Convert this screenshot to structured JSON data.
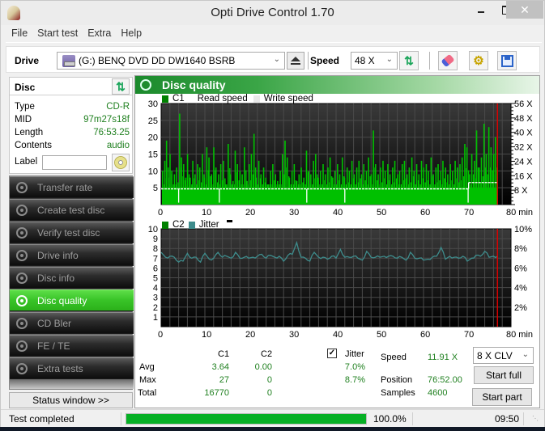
{
  "window": {
    "title": "Opti Drive Control 1.70",
    "controls": {
      "minimize": "–",
      "maximize": "□",
      "close": "✕"
    }
  },
  "menu": [
    "File",
    "Start test",
    "Extra",
    "Help"
  ],
  "toolbar": {
    "drive_label": "Drive",
    "drive_value": "(G:)  BENQ DVD DD DW1640 BSRB",
    "speed_label": "Speed",
    "speed_value": "48 X",
    "icons": [
      "drive-icon",
      "eject-icon",
      "refresh-icon",
      "erase-icon",
      "settings-icon",
      "save-icon"
    ]
  },
  "disc": {
    "title": "Disc",
    "fields": [
      {
        "key": "Type",
        "value": "CD-R"
      },
      {
        "key": "MID",
        "value": "97m27s18f"
      },
      {
        "key": "Length",
        "value": "76:53.25"
      },
      {
        "key": "Contents",
        "value": "audio"
      }
    ],
    "label_key": "Label",
    "label_value": ""
  },
  "nav": [
    {
      "label": "Transfer rate",
      "active": false
    },
    {
      "label": "Create test disc",
      "active": false
    },
    {
      "label": "Verify test disc",
      "active": false
    },
    {
      "label": "Drive info",
      "active": false
    },
    {
      "label": "Disc info",
      "active": false
    },
    {
      "label": "Disc quality",
      "active": true
    },
    {
      "label": "CD Bler",
      "active": false
    },
    {
      "label": "FE / TE",
      "active": false
    },
    {
      "label": "Extra tests",
      "active": false
    }
  ],
  "status_window_button": "Status window >>",
  "main": {
    "title": "Disc quality",
    "legend_top": [
      "C1",
      "Read speed",
      "Write speed"
    ],
    "legend_bottom": [
      "C2",
      "Jitter"
    ]
  },
  "colors": {
    "c1": "#00c000",
    "c1_legend": "#008000",
    "jitter": "#3e8c8c",
    "speed": "#ffffff",
    "end_marker": "#e00000",
    "accent_green": "#2bb11a",
    "value_green": "#208020"
  },
  "chart_data": [
    {
      "type": "bar",
      "title": "C1 / Read speed",
      "xlabel": "min",
      "xlim": [
        0,
        80
      ],
      "x_ticks": [
        "0",
        "10",
        "20",
        "30",
        "40",
        "50",
        "60",
        "70",
        "80 min"
      ],
      "ylim_left": [
        0,
        30
      ],
      "y_ticks_left": [
        "5",
        "10",
        "15",
        "20",
        "25",
        "30"
      ],
      "ylim_right": [
        0,
        56
      ],
      "y_ticks_right": [
        "8 X",
        "16 X",
        "24 X",
        "32 X",
        "40 X",
        "48 X",
        "56 X"
      ],
      "grid": true,
      "legend": "top-left",
      "end_marker_min": 76.9,
      "series": [
        {
          "name": "C1",
          "kind": "bars",
          "peaks": [
            [
              0.3,
              10
            ],
            [
              0.8,
              13
            ],
            [
              1.2,
              19
            ],
            [
              1.6,
              8
            ],
            [
              2.0,
              15
            ],
            [
              2.4,
              10
            ],
            [
              3.0,
              9
            ],
            [
              3.5,
              11
            ],
            [
              4.2,
              27
            ],
            [
              4.6,
              14
            ],
            [
              5.1,
              12
            ],
            [
              5.6,
              8
            ],
            [
              6.0,
              15
            ],
            [
              6.6,
              8
            ],
            [
              7.2,
              13
            ],
            [
              7.7,
              9
            ],
            [
              8.3,
              12
            ],
            [
              8.8,
              11
            ],
            [
              9.4,
              15
            ],
            [
              9.9,
              8
            ],
            [
              10.4,
              17
            ],
            [
              10.9,
              14
            ],
            [
              11.5,
              9
            ],
            [
              12.0,
              17
            ],
            [
              12.5,
              11
            ],
            [
              13.1,
              9
            ],
            [
              13.6,
              12
            ],
            [
              14.2,
              13
            ],
            [
              14.8,
              6
            ],
            [
              15.3,
              18
            ],
            [
              15.8,
              9
            ],
            [
              16.4,
              7
            ],
            [
              16.9,
              16
            ],
            [
              17.4,
              12
            ],
            [
              18.0,
              10
            ],
            [
              18.5,
              9
            ],
            [
              19.0,
              17
            ],
            [
              19.6,
              7
            ],
            [
              20.1,
              12
            ],
            [
              20.6,
              15
            ],
            [
              21.2,
              21
            ],
            [
              21.7,
              8
            ],
            [
              22.3,
              13
            ],
            [
              22.8,
              9
            ],
            [
              23.4,
              11
            ],
            [
              23.9,
              8
            ],
            [
              24.5,
              6
            ],
            [
              25.0,
              10
            ],
            [
              25.5,
              12
            ],
            [
              26.1,
              9
            ],
            [
              26.6,
              7
            ],
            [
              27.2,
              10
            ],
            [
              27.7,
              15
            ],
            [
              28.3,
              19
            ],
            [
              28.8,
              14
            ],
            [
              29.3,
              8
            ],
            [
              29.9,
              10
            ],
            [
              30.4,
              12
            ],
            [
              31.0,
              7
            ],
            [
              31.5,
              9
            ],
            [
              32.0,
              11
            ],
            [
              32.6,
              8
            ],
            [
              33.2,
              16
            ],
            [
              33.7,
              10
            ],
            [
              34.2,
              9
            ],
            [
              34.8,
              13
            ],
            [
              35.3,
              15
            ],
            [
              35.9,
              8
            ],
            [
              36.4,
              10
            ],
            [
              37.0,
              12
            ],
            [
              37.5,
              9
            ],
            [
              38.1,
              11
            ],
            [
              38.6,
              14
            ],
            [
              39.2,
              8
            ],
            [
              39.7,
              10
            ],
            [
              40.3,
              12
            ],
            [
              40.8,
              9
            ],
            [
              41.4,
              14
            ],
            [
              41.9,
              8
            ],
            [
              42.5,
              11
            ],
            [
              43.0,
              10
            ],
            [
              43.6,
              13
            ],
            [
              44.1,
              9
            ],
            [
              44.7,
              11
            ],
            [
              45.2,
              13
            ],
            [
              45.8,
              9
            ],
            [
              46.3,
              12
            ],
            [
              46.9,
              10
            ],
            [
              47.4,
              14
            ],
            [
              48.0,
              9
            ],
            [
              48.5,
              22
            ],
            [
              49.0,
              12
            ],
            [
              49.6,
              9
            ],
            [
              50.1,
              11
            ],
            [
              50.7,
              13
            ],
            [
              51.2,
              10
            ],
            [
              51.8,
              12
            ],
            [
              52.3,
              9
            ],
            [
              52.9,
              11
            ],
            [
              53.4,
              13
            ],
            [
              54.0,
              9
            ],
            [
              54.5,
              10
            ],
            [
              55.1,
              12
            ],
            [
              55.6,
              13
            ],
            [
              56.2,
              9
            ],
            [
              56.7,
              11
            ],
            [
              57.3,
              14
            ],
            [
              57.8,
              10
            ],
            [
              58.4,
              12
            ],
            [
              58.9,
              9
            ],
            [
              59.5,
              13
            ],
            [
              60.0,
              11
            ],
            [
              60.6,
              12
            ],
            [
              61.1,
              10
            ],
            [
              61.7,
              14
            ],
            [
              62.2,
              9
            ],
            [
              62.8,
              11
            ],
            [
              63.3,
              12
            ],
            [
              63.9,
              10
            ],
            [
              64.4,
              13
            ],
            [
              65.0,
              11
            ],
            [
              65.5,
              9
            ],
            [
              66.1,
              12
            ],
            [
              66.6,
              10
            ],
            [
              67.2,
              13
            ],
            [
              67.7,
              11
            ],
            [
              68.3,
              12
            ],
            [
              68.8,
              14
            ],
            [
              69.4,
              18
            ],
            [
              69.9,
              17
            ],
            [
              70.5,
              9
            ],
            [
              71.0,
              15
            ],
            [
              71.6,
              13
            ],
            [
              72.1,
              22
            ],
            [
              72.7,
              11
            ],
            [
              73.2,
              14
            ],
            [
              73.8,
              24
            ],
            [
              74.3,
              15
            ],
            [
              74.9,
              23
            ],
            [
              75.4,
              17
            ],
            [
              76.0,
              15
            ],
            [
              76.4,
              20
            ],
            [
              76.8,
              10
            ]
          ],
          "baseline": 5
        },
        {
          "name": "Read speed",
          "kind": "line",
          "unit": "X",
          "segments": [
            {
              "from_min": 0,
              "to_min": 70.3,
              "value_x": 8.7
            },
            {
              "from_min": 70.3,
              "to_min": 76.9,
              "value_x": 12.2
            }
          ],
          "dips_min": [
            4.0,
            13.3,
            33.3,
            42.0,
            70.2
          ]
        },
        {
          "name": "Write speed",
          "kind": "line",
          "values": []
        }
      ]
    },
    {
      "type": "line",
      "title": "C2 / Jitter",
      "xlabel": "min",
      "xlim": [
        0,
        80
      ],
      "x_ticks": [
        "0",
        "10",
        "20",
        "30",
        "40",
        "50",
        "60",
        "70",
        "80 min"
      ],
      "ylim_left": [
        0,
        10
      ],
      "y_ticks_left": [
        "1",
        "2",
        "3",
        "4",
        "5",
        "6",
        "7",
        "8",
        "9",
        "10"
      ],
      "ylim_right": [
        0,
        10
      ],
      "y_ticks_right": [
        "2%",
        "4%",
        "6%",
        "8%",
        "10%"
      ],
      "grid": true,
      "legend": "top-left",
      "end_marker_min": 76.9,
      "series": [
        {
          "name": "C2",
          "values": [
            0
          ]
        },
        {
          "name": "Jitter",
          "unit": "%",
          "x": [
            0,
            1,
            2,
            3,
            4,
            5,
            6,
            7,
            8,
            9,
            10,
            11,
            12,
            13,
            14,
            15,
            16,
            17,
            18,
            19,
            20,
            21,
            22,
            23,
            24,
            25,
            26,
            27,
            28,
            29,
            30,
            31,
            32,
            33,
            34,
            35,
            36,
            37,
            38,
            39,
            40,
            41,
            42,
            43,
            44,
            45,
            46,
            47,
            48,
            49,
            50,
            51,
            52,
            53,
            54,
            55,
            56,
            57,
            58,
            59,
            60,
            61,
            62,
            63,
            64,
            65,
            66,
            67,
            68,
            69,
            70,
            71,
            72,
            73,
            74,
            75,
            76,
            76.9
          ],
          "values": [
            7.6,
            7.1,
            7.2,
            7.1,
            6.6,
            6.7,
            7.5,
            7.0,
            7.1,
            6.6,
            7.5,
            6.9,
            7.0,
            7.6,
            7.1,
            7.2,
            7.0,
            7.6,
            7.0,
            7.1,
            7.0,
            7.1,
            7.2,
            7.4,
            7.0,
            7.3,
            7.1,
            7.2,
            6.7,
            7.3,
            7.4,
            8.6,
            7.1,
            7.0,
            6.7,
            7.6,
            7.1,
            7.1,
            6.9,
            7.2,
            7.0,
            7.9,
            7.1,
            7.1,
            7.2,
            7.0,
            6.8,
            7.7,
            7.1,
            7.1,
            7.1,
            7.2,
            7.2,
            7.2,
            7.0,
            7.1,
            6.8,
            7.6,
            7.0,
            7.0,
            6.8,
            6.9,
            7.1,
            7.2,
            8.1,
            6.9,
            7.2,
            7.1,
            7.0,
            7.2,
            6.7,
            7.0,
            7.3,
            7.2,
            7.7,
            7.1,
            7.2,
            7.2
          ]
        }
      ]
    }
  ],
  "stats": {
    "headers": [
      "C1",
      "C2"
    ],
    "jitter_label": "Jitter",
    "jitter_checked": true,
    "rows": [
      {
        "label": "Avg",
        "c1": "3.64",
        "c2": "0.00",
        "jitter": "7.0%"
      },
      {
        "label": "Max",
        "c1": "27",
        "c2": "0",
        "jitter": "8.7%"
      },
      {
        "label": "Total",
        "c1": "16770",
        "c2": "0",
        "jitter": ""
      }
    ]
  },
  "run": {
    "speed_label": "Speed",
    "speed_value": "11.91 X",
    "position_label": "Position",
    "position_value": "76:52.00",
    "samples_label": "Samples",
    "samples_value": "4600",
    "mode_value": "8 X CLV",
    "start_full": "Start full",
    "start_part": "Start part"
  },
  "statusbar": {
    "text": "Test completed",
    "progress_percent": 100.0,
    "progress_text": "100.0%",
    "elapsed": "09:50"
  }
}
